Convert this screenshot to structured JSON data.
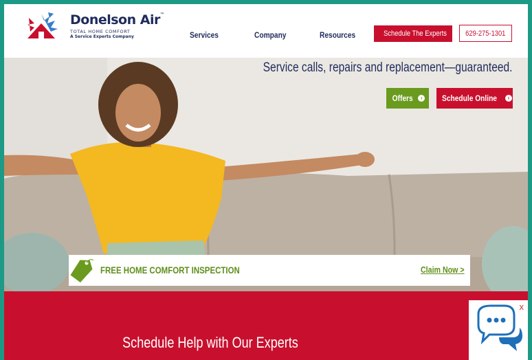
{
  "brand": {
    "name": "Donelson Air",
    "trademark": "™",
    "tagline": "TOTAL HOME COMFORT",
    "subtag": "A Service Experts Company"
  },
  "nav": {
    "items": [
      "Services",
      "Company",
      "Resources"
    ]
  },
  "header_buttons": {
    "schedule": "Schedule The Experts",
    "phone": "629-275-1301"
  },
  "hero": {
    "tagline": "Service calls, repairs and replacement—guaranteed.",
    "offers": "Offers",
    "schedule_online": "Schedule Online"
  },
  "promo": {
    "text": "FREE HOME COMFORT INSPECTION",
    "link": "Claim Now >"
  },
  "bottom": {
    "title": "Schedule Help with Our Experts"
  },
  "chat": {
    "close": "x"
  },
  "colors": {
    "brand_red": "#c8102e",
    "brand_green": "#6a9b1f",
    "navy": "#1f2b5c",
    "frame_teal": "#1d9a86"
  }
}
